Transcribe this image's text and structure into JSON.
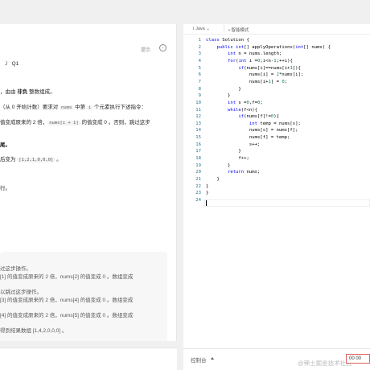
{
  "problem": {
    "hint_label": "提示",
    "tag_q": "Q1",
    "line1_prefix": "，由由 ",
    "line1_bold": "非负",
    "line1_suffix": " 整数组成。",
    "line2_a": "（从 0 开始计数）要求对 ",
    "line2_code1": "nums",
    "line2_b": " 中第 ",
    "line2_code2": "i",
    "line2_c": " 个元素执行下述指令：",
    "line3_a": "值变成原来的 2 倍，",
    "line3_code": "nums[i + 1]",
    "line3_b": " 的值变成 0 。否则，跳过这步",
    "line4": "尾。",
    "line5_a": "后变为 ",
    "line5_code": "[1,2,1,0,0,0]",
    "line5_b": " 。",
    "line6": "行。",
    "ex_line1": "过这步操作。",
    "ex_line2": "[1] 的值变成原来的 2 倍，nums[2] 的值变成 0 。数组变成",
    "ex_line3": "以跳过这步操作。",
    "ex_line4": "[3] 的值变成原来的 2 倍，nums[4] 的值变成 0 。数组变成",
    "ex_line5": "[4] 的值变成原来的 2 倍，nums[5] 的值变成 0 。数组变成",
    "ex_line6": "得到结果数组 [1,4,2,0,0,0] 。"
  },
  "editor": {
    "language": "Java",
    "mode": "智能模式",
    "lines": [
      {
        "n": "1",
        "t": "class Solution {"
      },
      {
        "n": "2",
        "t": "    public int[] applyOperations(int[] nums) {"
      },
      {
        "n": "3",
        "t": "        int n = nums.length;"
      },
      {
        "n": "4",
        "t": "        for(int i =0;i<n-1;++i){"
      },
      {
        "n": "5",
        "t": "            if(nums[i]==nums[i+1]){"
      },
      {
        "n": "6",
        "t": "                nums[i] = 2*nums[i];"
      },
      {
        "n": "7",
        "t": "                nums[i+1] = 0;"
      },
      {
        "n": "8",
        "t": "            }"
      },
      {
        "n": "9",
        "t": "        }"
      },
      {
        "n": "10",
        "t": "        int s =0,f=0;"
      },
      {
        "n": "11",
        "t": "        while(f<n){"
      },
      {
        "n": "12",
        "t": "            if(nums[f]!=0){"
      },
      {
        "n": "13",
        "t": "                int temp = nums[s];"
      },
      {
        "n": "14",
        "t": "                nums[s] = nums[f];"
      },
      {
        "n": "15",
        "t": "                nums[f] = temp;"
      },
      {
        "n": "16",
        "t": "                s++;"
      },
      {
        "n": "17",
        "t": "            }"
      },
      {
        "n": "18",
        "t": "            f++;"
      },
      {
        "n": "19",
        "t": "        }"
      },
      {
        "n": "20",
        "t": "        return nums;"
      },
      {
        "n": "21",
        "t": "    }"
      },
      {
        "n": "22",
        "t": "}"
      },
      {
        "n": "23",
        "t": "}"
      },
      {
        "n": "24",
        "t": ""
      }
    ]
  },
  "console": {
    "label": "控制台",
    "timer": "00 00"
  },
  "watermark": "@稀土掘金技术社区"
}
